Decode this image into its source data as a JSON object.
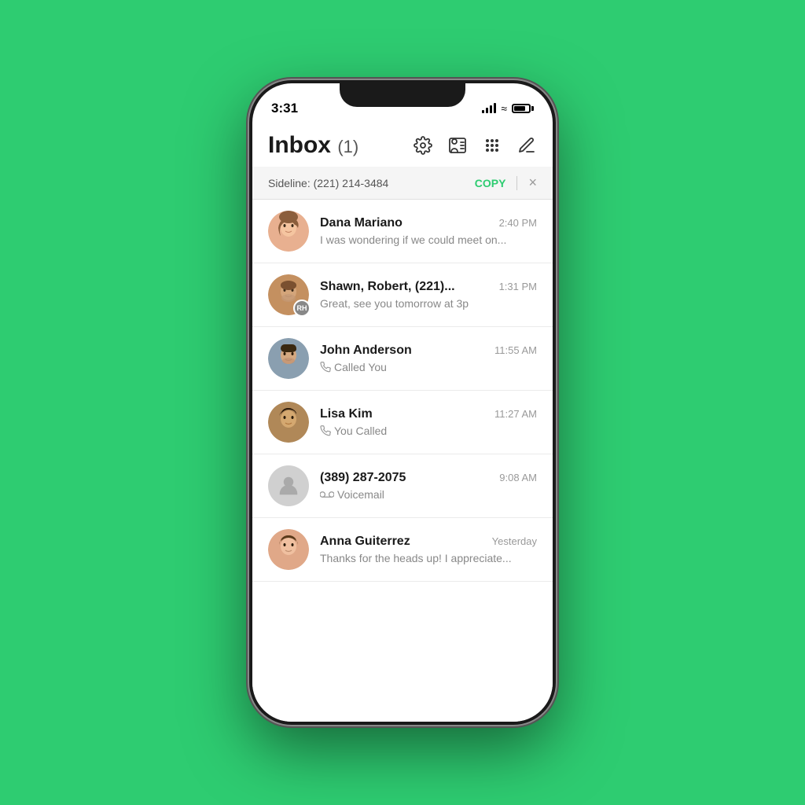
{
  "background_color": "#2ecc71",
  "status_bar": {
    "time": "3:31",
    "signal": "full",
    "wifi": true,
    "battery": "full"
  },
  "header": {
    "title": "Inbox",
    "badge": "(1)",
    "icons": [
      "settings",
      "contacts",
      "grid",
      "compose"
    ]
  },
  "sideline": {
    "label": "Sideline: (221) 214-3484",
    "copy_label": "COPY",
    "close_label": "×"
  },
  "inbox_items": [
    {
      "id": 1,
      "name": "Dana Mariano",
      "time": "2:40 PM",
      "preview": "I was wondering if we could meet on...",
      "type": "message",
      "unread": true,
      "avatar_color": "#e8a080"
    },
    {
      "id": 2,
      "name": "Shawn, Robert, (221)...",
      "time": "1:31 PM",
      "preview": "Great, see you tomorrow at 3p",
      "type": "message",
      "unread": false,
      "avatar_initials": "RH",
      "avatar_color": "#888888"
    },
    {
      "id": 3,
      "name": "John Anderson",
      "time": "11:55 AM",
      "preview": "Called You",
      "type": "call_received",
      "unread": false,
      "avatar_color": "#7a8fa0"
    },
    {
      "id": 4,
      "name": "Lisa Kim",
      "time": "11:27 AM",
      "preview": "You Called",
      "type": "call_made",
      "unread": false,
      "avatar_color": "#a07848"
    },
    {
      "id": 5,
      "name": "(389) 287-2075",
      "time": "9:08 AM",
      "preview": "Voicemail",
      "type": "voicemail",
      "unread": false,
      "avatar_color": "#cccccc"
    },
    {
      "id": 6,
      "name": "Anna Guiterrez",
      "time": "Yesterday",
      "preview": "Thanks for the heads up! I appreciate...",
      "type": "message",
      "unread": false,
      "avatar_color": "#e09080"
    }
  ]
}
